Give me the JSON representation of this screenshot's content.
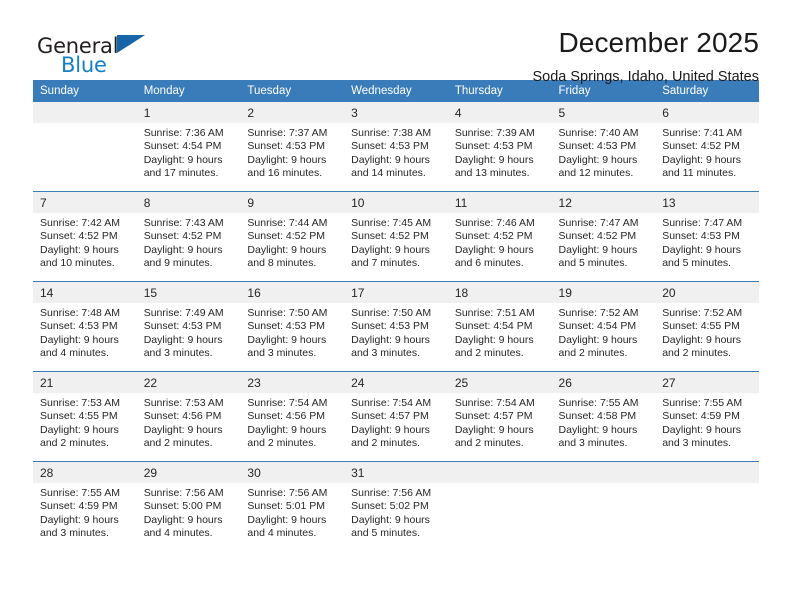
{
  "brand": {
    "name_top": "General",
    "name_bottom": "Blue",
    "accent_color": "#1580c4",
    "triangle_color": "#1565a8"
  },
  "header": {
    "title": "December 2025",
    "subtitle": "Soda Springs, Idaho, United States"
  },
  "theme": {
    "header_row_bg": "#3a7cb9",
    "header_row_text": "#ffffff",
    "daynum_bg": "#f0f0f0",
    "cell_bg": "#ffffff",
    "divider": "#3a7cb9"
  },
  "weekdays": [
    "Sunday",
    "Monday",
    "Tuesday",
    "Wednesday",
    "Thursday",
    "Friday",
    "Saturday"
  ],
  "weeks": [
    [
      {
        "day": "",
        "sunrise": "",
        "sunset": "",
        "daylight_line1": "",
        "daylight_line2": ""
      },
      {
        "day": "1",
        "sunrise": "Sunrise: 7:36 AM",
        "sunset": "Sunset: 4:54 PM",
        "daylight_line1": "Daylight: 9 hours",
        "daylight_line2": "and 17 minutes."
      },
      {
        "day": "2",
        "sunrise": "Sunrise: 7:37 AM",
        "sunset": "Sunset: 4:53 PM",
        "daylight_line1": "Daylight: 9 hours",
        "daylight_line2": "and 16 minutes."
      },
      {
        "day": "3",
        "sunrise": "Sunrise: 7:38 AM",
        "sunset": "Sunset: 4:53 PM",
        "daylight_line1": "Daylight: 9 hours",
        "daylight_line2": "and 14 minutes."
      },
      {
        "day": "4",
        "sunrise": "Sunrise: 7:39 AM",
        "sunset": "Sunset: 4:53 PM",
        "daylight_line1": "Daylight: 9 hours",
        "daylight_line2": "and 13 minutes."
      },
      {
        "day": "5",
        "sunrise": "Sunrise: 7:40 AM",
        "sunset": "Sunset: 4:53 PM",
        "daylight_line1": "Daylight: 9 hours",
        "daylight_line2": "and 12 minutes."
      },
      {
        "day": "6",
        "sunrise": "Sunrise: 7:41 AM",
        "sunset": "Sunset: 4:52 PM",
        "daylight_line1": "Daylight: 9 hours",
        "daylight_line2": "and 11 minutes."
      }
    ],
    [
      {
        "day": "7",
        "sunrise": "Sunrise: 7:42 AM",
        "sunset": "Sunset: 4:52 PM",
        "daylight_line1": "Daylight: 9 hours",
        "daylight_line2": "and 10 minutes."
      },
      {
        "day": "8",
        "sunrise": "Sunrise: 7:43 AM",
        "sunset": "Sunset: 4:52 PM",
        "daylight_line1": "Daylight: 9 hours",
        "daylight_line2": "and 9 minutes."
      },
      {
        "day": "9",
        "sunrise": "Sunrise: 7:44 AM",
        "sunset": "Sunset: 4:52 PM",
        "daylight_line1": "Daylight: 9 hours",
        "daylight_line2": "and 8 minutes."
      },
      {
        "day": "10",
        "sunrise": "Sunrise: 7:45 AM",
        "sunset": "Sunset: 4:52 PM",
        "daylight_line1": "Daylight: 9 hours",
        "daylight_line2": "and 7 minutes."
      },
      {
        "day": "11",
        "sunrise": "Sunrise: 7:46 AM",
        "sunset": "Sunset: 4:52 PM",
        "daylight_line1": "Daylight: 9 hours",
        "daylight_line2": "and 6 minutes."
      },
      {
        "day": "12",
        "sunrise": "Sunrise: 7:47 AM",
        "sunset": "Sunset: 4:52 PM",
        "daylight_line1": "Daylight: 9 hours",
        "daylight_line2": "and 5 minutes."
      },
      {
        "day": "13",
        "sunrise": "Sunrise: 7:47 AM",
        "sunset": "Sunset: 4:53 PM",
        "daylight_line1": "Daylight: 9 hours",
        "daylight_line2": "and 5 minutes."
      }
    ],
    [
      {
        "day": "14",
        "sunrise": "Sunrise: 7:48 AM",
        "sunset": "Sunset: 4:53 PM",
        "daylight_line1": "Daylight: 9 hours",
        "daylight_line2": "and 4 minutes."
      },
      {
        "day": "15",
        "sunrise": "Sunrise: 7:49 AM",
        "sunset": "Sunset: 4:53 PM",
        "daylight_line1": "Daylight: 9 hours",
        "daylight_line2": "and 3 minutes."
      },
      {
        "day": "16",
        "sunrise": "Sunrise: 7:50 AM",
        "sunset": "Sunset: 4:53 PM",
        "daylight_line1": "Daylight: 9 hours",
        "daylight_line2": "and 3 minutes."
      },
      {
        "day": "17",
        "sunrise": "Sunrise: 7:50 AM",
        "sunset": "Sunset: 4:53 PM",
        "daylight_line1": "Daylight: 9 hours",
        "daylight_line2": "and 3 minutes."
      },
      {
        "day": "18",
        "sunrise": "Sunrise: 7:51 AM",
        "sunset": "Sunset: 4:54 PM",
        "daylight_line1": "Daylight: 9 hours",
        "daylight_line2": "and 2 minutes."
      },
      {
        "day": "19",
        "sunrise": "Sunrise: 7:52 AM",
        "sunset": "Sunset: 4:54 PM",
        "daylight_line1": "Daylight: 9 hours",
        "daylight_line2": "and 2 minutes."
      },
      {
        "day": "20",
        "sunrise": "Sunrise: 7:52 AM",
        "sunset": "Sunset: 4:55 PM",
        "daylight_line1": "Daylight: 9 hours",
        "daylight_line2": "and 2 minutes."
      }
    ],
    [
      {
        "day": "21",
        "sunrise": "Sunrise: 7:53 AM",
        "sunset": "Sunset: 4:55 PM",
        "daylight_line1": "Daylight: 9 hours",
        "daylight_line2": "and 2 minutes."
      },
      {
        "day": "22",
        "sunrise": "Sunrise: 7:53 AM",
        "sunset": "Sunset: 4:56 PM",
        "daylight_line1": "Daylight: 9 hours",
        "daylight_line2": "and 2 minutes."
      },
      {
        "day": "23",
        "sunrise": "Sunrise: 7:54 AM",
        "sunset": "Sunset: 4:56 PM",
        "daylight_line1": "Daylight: 9 hours",
        "daylight_line2": "and 2 minutes."
      },
      {
        "day": "24",
        "sunrise": "Sunrise: 7:54 AM",
        "sunset": "Sunset: 4:57 PM",
        "daylight_line1": "Daylight: 9 hours",
        "daylight_line2": "and 2 minutes."
      },
      {
        "day": "25",
        "sunrise": "Sunrise: 7:54 AM",
        "sunset": "Sunset: 4:57 PM",
        "daylight_line1": "Daylight: 9 hours",
        "daylight_line2": "and 2 minutes."
      },
      {
        "day": "26",
        "sunrise": "Sunrise: 7:55 AM",
        "sunset": "Sunset: 4:58 PM",
        "daylight_line1": "Daylight: 9 hours",
        "daylight_line2": "and 3 minutes."
      },
      {
        "day": "27",
        "sunrise": "Sunrise: 7:55 AM",
        "sunset": "Sunset: 4:59 PM",
        "daylight_line1": "Daylight: 9 hours",
        "daylight_line2": "and 3 minutes."
      }
    ],
    [
      {
        "day": "28",
        "sunrise": "Sunrise: 7:55 AM",
        "sunset": "Sunset: 4:59 PM",
        "daylight_line1": "Daylight: 9 hours",
        "daylight_line2": "and 3 minutes."
      },
      {
        "day": "29",
        "sunrise": "Sunrise: 7:56 AM",
        "sunset": "Sunset: 5:00 PM",
        "daylight_line1": "Daylight: 9 hours",
        "daylight_line2": "and 4 minutes."
      },
      {
        "day": "30",
        "sunrise": "Sunrise: 7:56 AM",
        "sunset": "Sunset: 5:01 PM",
        "daylight_line1": "Daylight: 9 hours",
        "daylight_line2": "and 4 minutes."
      },
      {
        "day": "31",
        "sunrise": "Sunrise: 7:56 AM",
        "sunset": "Sunset: 5:02 PM",
        "daylight_line1": "Daylight: 9 hours",
        "daylight_line2": "and 5 minutes."
      },
      {
        "day": "",
        "sunrise": "",
        "sunset": "",
        "daylight_line1": "",
        "daylight_line2": ""
      },
      {
        "day": "",
        "sunrise": "",
        "sunset": "",
        "daylight_line1": "",
        "daylight_line2": ""
      },
      {
        "day": "",
        "sunrise": "",
        "sunset": "",
        "daylight_line1": "",
        "daylight_line2": ""
      }
    ]
  ]
}
